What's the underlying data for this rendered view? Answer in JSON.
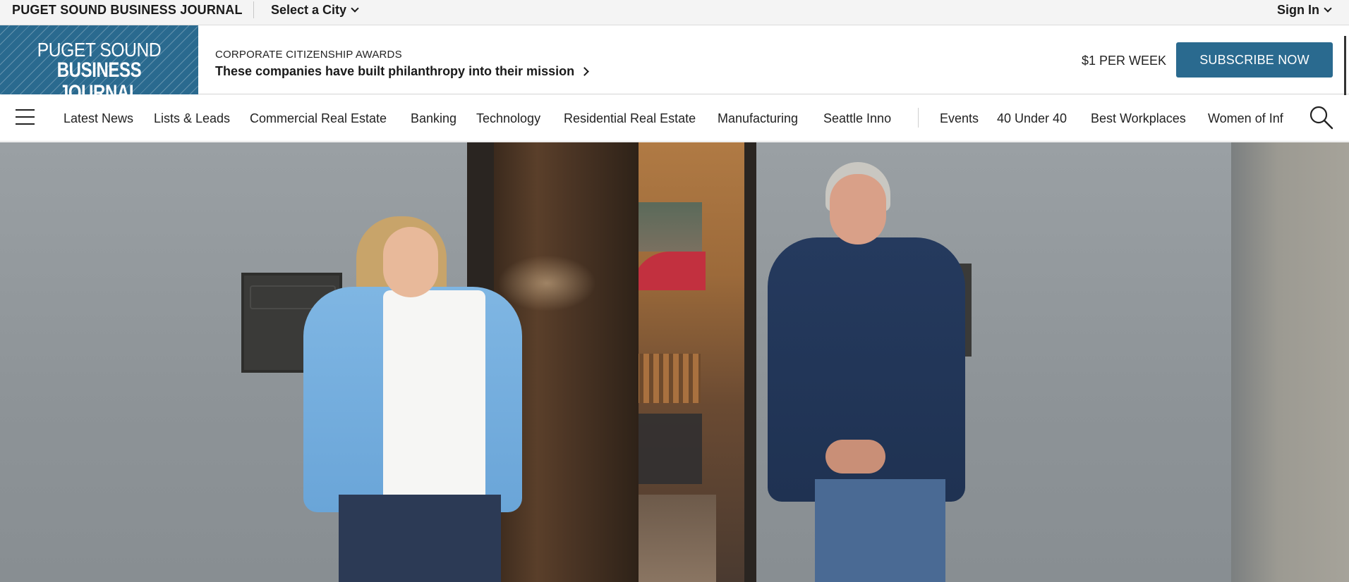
{
  "topbar": {
    "brand": "PUGET SOUND BUSINESS JOURNAL",
    "city_select": "Select a City",
    "sign_in": "Sign In"
  },
  "header": {
    "logo_line1": "PUGET SOUND",
    "logo_line2": "BUSINESS JOURNAL",
    "promo_kicker": "CORPORATE CITIZENSHIP AWARDS",
    "promo_headline": "These companies have built philanthropy into their mission",
    "price": "$1 PER WEEK",
    "subscribe": "SUBSCRIBE NOW"
  },
  "nav": {
    "items_left": [
      "Latest News",
      "Lists & Leads",
      "Commercial Real Estate",
      "Banking",
      "Technology",
      "Residential Real Estate",
      "Manufacturing",
      "Seattle Inno"
    ],
    "items_right": [
      "Events",
      "40 Under 40",
      "Best Workplaces",
      "Women of Inf"
    ]
  },
  "colors": {
    "brand_blue": "#2a6a8f",
    "topbar_bg": "#f4f4f4"
  },
  "icons": [
    "chevron-down-icon",
    "chevron-right-icon",
    "hamburger-menu-icon",
    "search-icon"
  ]
}
